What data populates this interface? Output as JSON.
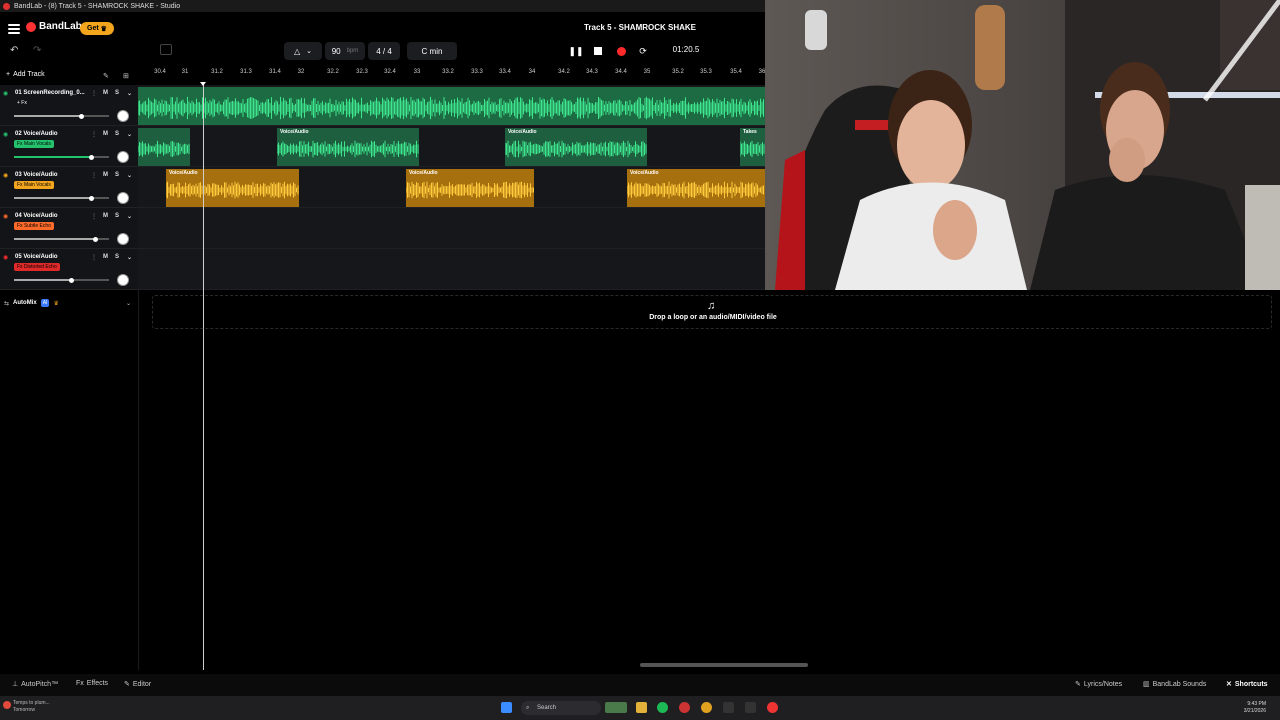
{
  "window": {
    "title": "BandLab - (8) Track 5 - SHAMROCK SHAKE - Studio"
  },
  "header": {
    "logo_text": "BandLab",
    "get_label": "Get",
    "song_title": "Track 5 - SHAMROCK SHAKE",
    "bpm": "90",
    "bpm_unit": "bpm",
    "time_signature": "4 / 4",
    "key": "C min",
    "timecode": "01:20.5"
  },
  "toolbar": {
    "add_track_label": "Add Track"
  },
  "ruler": {
    "labels": [
      "30.4",
      "31",
      "31.2",
      "31.3",
      "31.4",
      "32",
      "32.2",
      "32.3",
      "32.4",
      "33",
      "33.2",
      "33.3",
      "33.4",
      "34",
      "34.2",
      "34.3",
      "34.4",
      "35",
      "35.2",
      "35.3",
      "35.4",
      "36"
    ]
  },
  "tracks": [
    {
      "name": "01 ScreenRecording_0...",
      "fx": "+ Fx",
      "color": "#25c26e",
      "fx_color": "",
      "volume": 0.7
    },
    {
      "name": "02 Voice/Audio",
      "fx": "Fx Main Vocals",
      "color": "#25c26e",
      "fx_color": "#25c26e",
      "volume": 0.81
    },
    {
      "name": "03 Voice/Audio",
      "fx": "Fx Main Vocals",
      "color": "#f2a51d",
      "fx_color": "#f2a51d",
      "volume": 0.81
    },
    {
      "name": "04 Voice/Audio",
      "fx": "Fx Subtle Echo",
      "color": "#ff6a2a",
      "fx_color": "#ff6a2a",
      "volume": 0.85
    },
    {
      "name": "05 Voice/Audio",
      "fx": "Fx Distorted Echo",
      "color": "#ff3030",
      "fx_color": "#e02a2a",
      "volume": 0.6
    }
  ],
  "clips": {
    "voice_label": "Voice/Audio",
    "takes_label": "Takes"
  },
  "track_buttons": {
    "mute": "M",
    "solo": "S"
  },
  "automix": {
    "label": "AutoMix",
    "badge": "AI"
  },
  "dropzone": {
    "text": "Drop a loop or an audio/MIDI/video file"
  },
  "bottombar": {
    "autopitch": "AutoPitch™",
    "effects": "Effects",
    "editor": "Editor",
    "lyrics": "Lyrics/Notes",
    "sounds": "BandLab Sounds",
    "shortcuts": "Shortcuts"
  },
  "taskbar": {
    "weather_line1": "Temps to plum...",
    "weather_line2": "Tomorrow",
    "search_placeholder": "Search",
    "time": "9:43 PM",
    "date": "3/21/2026"
  },
  "colors": {
    "green": "#25c26e",
    "yellow": "#f2a51d",
    "accent": "#3b7bff"
  }
}
